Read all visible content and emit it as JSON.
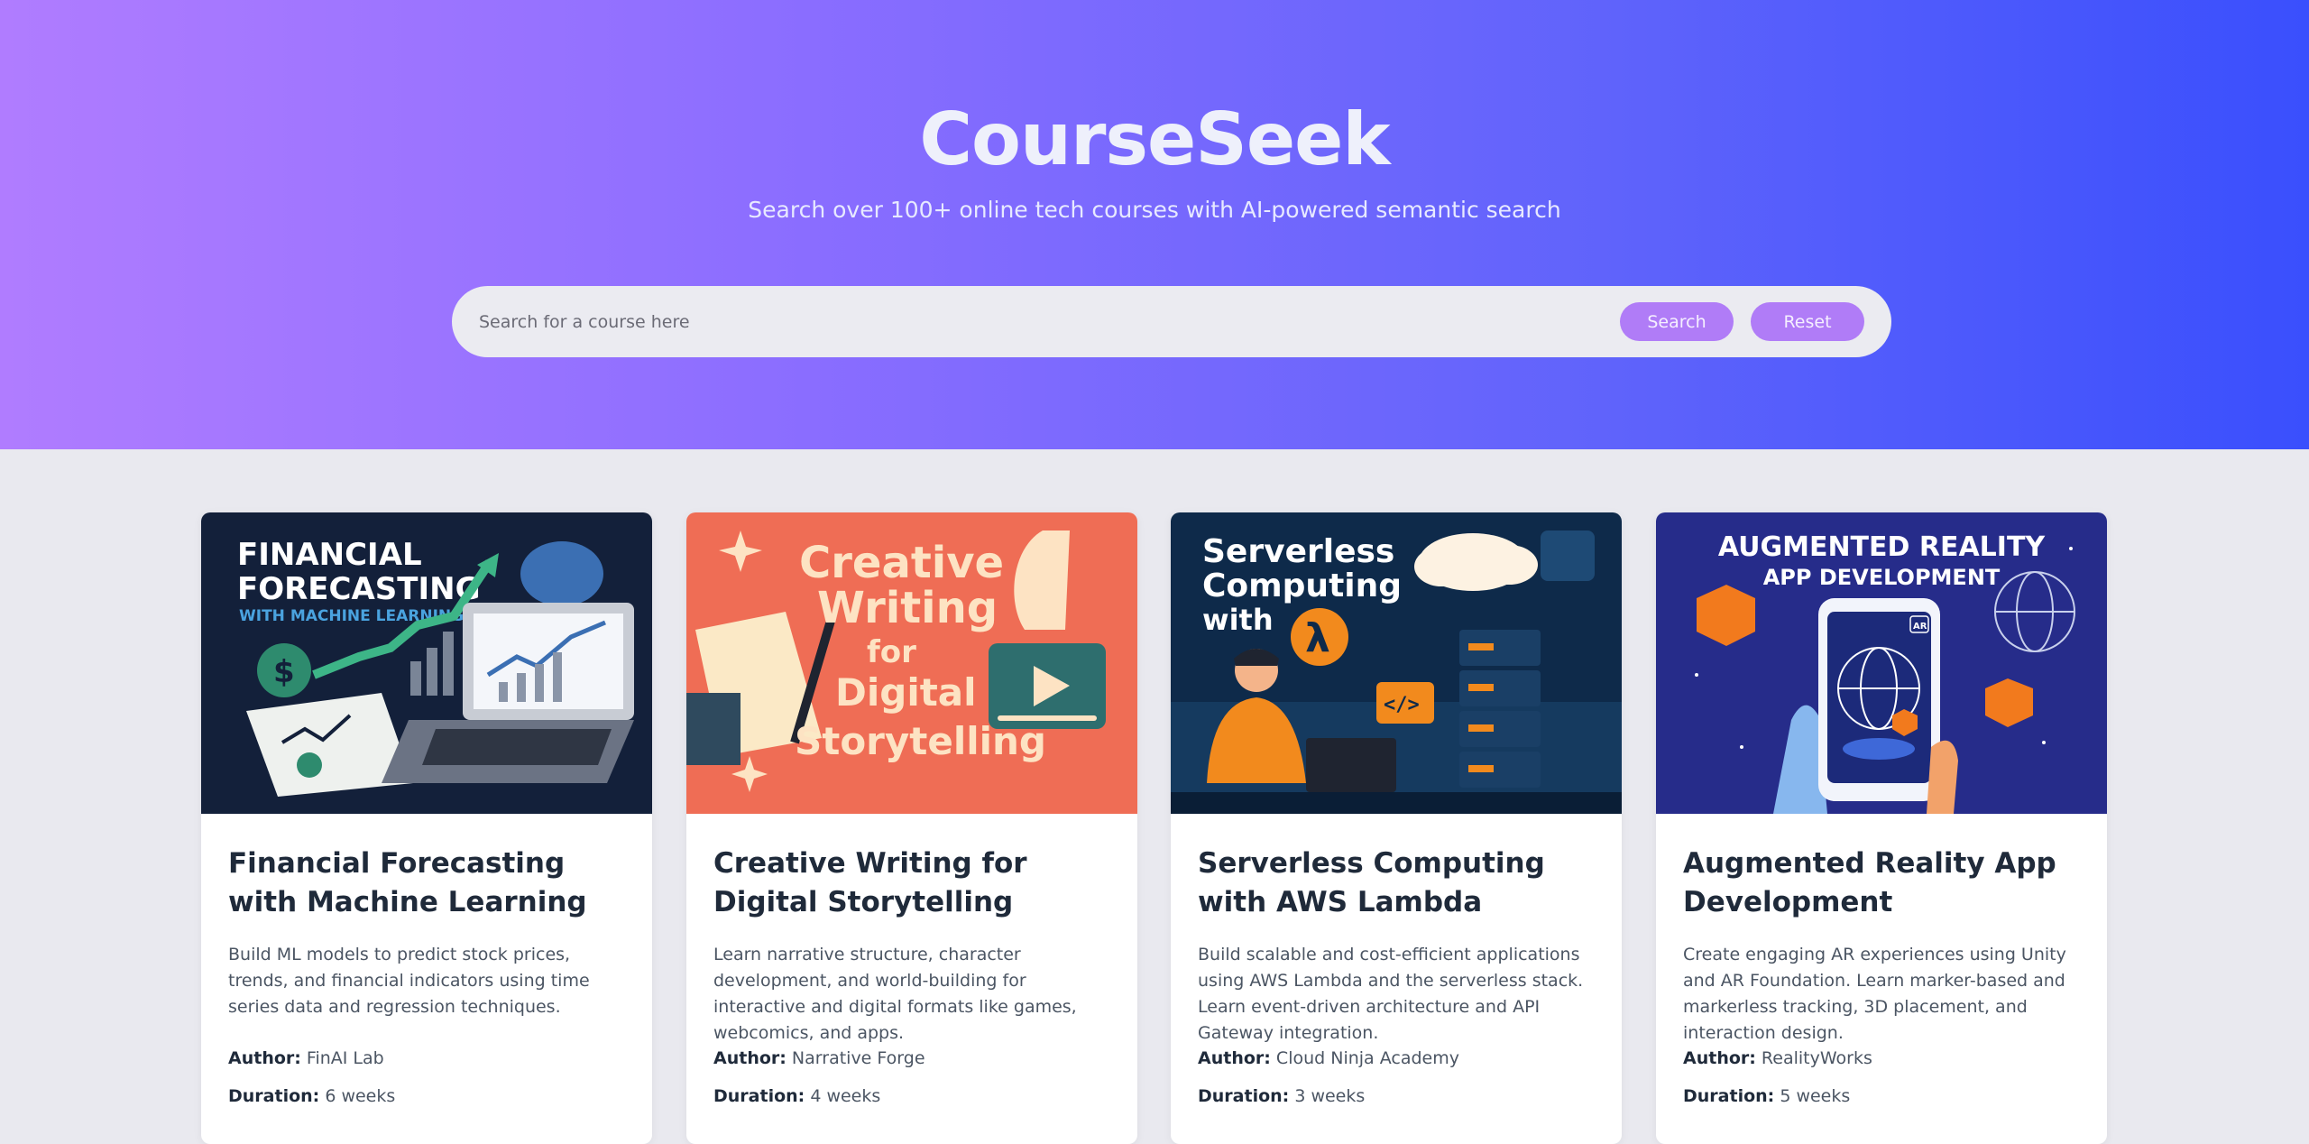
{
  "app": {
    "title": "CourseSeek",
    "subtitle": "Search over 100+ online tech courses with AI-powered semantic search"
  },
  "search": {
    "placeholder": "Search for a course here",
    "value": "",
    "search_label": "Search",
    "reset_label": "Reset"
  },
  "labels": {
    "author": "Author:",
    "duration": "Duration:"
  },
  "courses": [
    {
      "title": "Financial Forecasting with Machine Learning",
      "description": "Build ML models to predict stock prices, trends, and financial indicators using time series data and regression techniques.",
      "author": "FinAI Lab",
      "duration": "6 weeks",
      "image_text": [
        "FINANCIAL",
        "FORECASTING",
        "WITH MACHINE LEARNING"
      ]
    },
    {
      "title": "Creative Writing for Digital Storytelling",
      "description": "Learn narrative structure, character development, and world-building for interactive and digital formats like games, webcomics, and apps.",
      "author": "Narrative Forge",
      "duration": "4 weeks",
      "image_text": [
        "Creative",
        "Writing",
        "for",
        "Digital",
        "Storytelling"
      ]
    },
    {
      "title": "Serverless Computing with AWS Lambda",
      "description": "Build scalable and cost-efficient applications using AWS Lambda and the serverless stack. Learn event-driven architecture and API Gateway integration.",
      "author": "Cloud Ninja Academy",
      "duration": "3 weeks",
      "image_text": [
        "Serverless",
        "Computing",
        "with",
        "λ",
        "</>"
      ]
    },
    {
      "title": "Augmented Reality App Development",
      "description": "Create engaging AR experiences using Unity and AR Foundation. Learn marker-based and markerless tracking, 3D placement, and interaction design.",
      "author": "RealityWorks",
      "duration": "5 weeks",
      "image_text": [
        "AUGMENTED REALITY",
        "APP DEVELOPMENT",
        "AR"
      ]
    }
  ]
}
